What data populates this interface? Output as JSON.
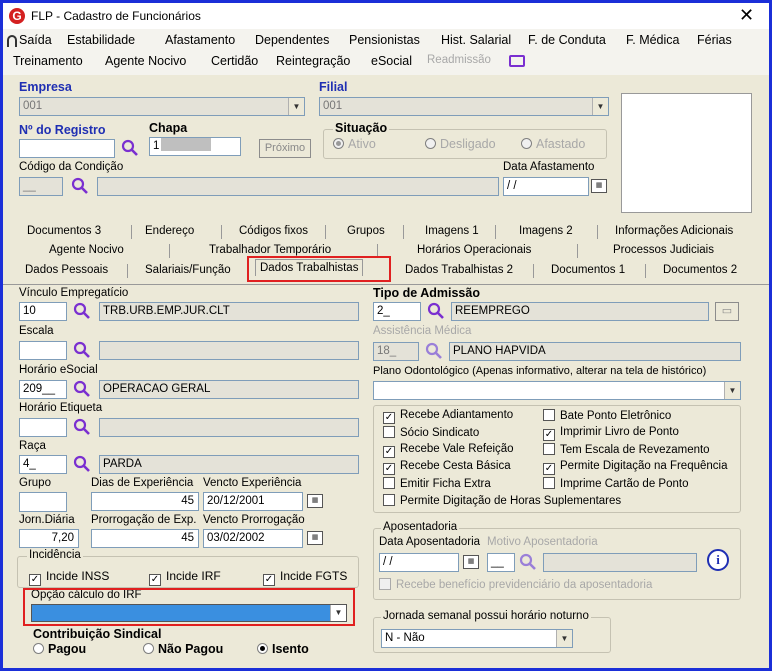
{
  "window": {
    "title": "FLP - Cadastro de Funcionários",
    "close": "✕",
    "logo": "G"
  },
  "menu": {
    "row1": [
      "Saída",
      "Estabilidade",
      "Afastamento",
      "Dependentes",
      "Pensionistas",
      "Hist. Salarial",
      "F. de Conduta",
      "F. Médica",
      "Férias"
    ],
    "row2": [
      "Treinamento",
      "Agente Nocivo",
      "Certidão",
      "Reintegração",
      "eSocial",
      "Readmissão"
    ]
  },
  "header": {
    "empresa_label": "Empresa",
    "empresa_value": "001",
    "filial_label": "Filial",
    "filial_value": "001",
    "registro_label": "Nº do Registro",
    "chapa_label": "Chapa",
    "chapa_value": "1",
    "proximo_button": "Próximo",
    "situacao_label": "Situação",
    "situacao_options": [
      "Ativo",
      "Desligado",
      "Afastado"
    ],
    "codigo_condicao_label": "Código da Condição",
    "codigo_condicao_value": "__",
    "data_afastamento_label": "Data Afastamento",
    "data_afastamento_value": " / /"
  },
  "tabs": {
    "row1": [
      "Documentos 3",
      "Endereço",
      "Códigos fixos",
      "Grupos",
      "Imagens 1",
      "Imagens 2",
      "Informações Adicionais"
    ],
    "row2": [
      "Agente Nocivo",
      "Trabalhador Temporário",
      "Horários Operacionais",
      "Processos Judiciais"
    ],
    "row3": [
      "Dados Pessoais",
      "Salariais/Função",
      "Dados Trabalhistas",
      "Dados Trabalhistas 2",
      "Documentos 1",
      "Documentos 2"
    ],
    "active": "Dados Trabalhistas"
  },
  "left": {
    "vinculo_label": "Vínculo Empregatício",
    "vinculo_code": "10",
    "vinculo_desc": "TRB.URB.EMP.JUR.CLT",
    "escala_label": "Escala",
    "horario_esocial_label": "Horário eSocial",
    "horario_esocial_code": "209__",
    "horario_esocial_desc": "OPERACAO GERAL",
    "horario_etiqueta_label": "Horário Etiqueta",
    "raca_label": "Raça",
    "raca_code": "4_",
    "raca_desc": "PARDA",
    "grupo_label": "Grupo",
    "dias_exp_label": "Dias de Experiência",
    "dias_exp_value": "45",
    "vencto_exp_label": "Vencto Experiência",
    "vencto_exp_value": "20/12/2001",
    "jorn_diaria_label": "Jorn.Diária",
    "jorn_diaria_value": "7,20",
    "prorrogacao_label": "Prorrogação de Exp.",
    "prorrogacao_value": "45",
    "vencto_prorrog_label": "Vencto Prorrogação",
    "vencto_prorrog_value": "03/02/2002",
    "incidencia_label": "Incidência",
    "incide_inss": "Incide INSS",
    "incide_irf": "Incide IRF",
    "incide_fgts": "Incide FGTS",
    "opcao_irf_label": "Opção cálculo do IRF",
    "contribuicao_label": "Contribuição Sindical",
    "contribuicao_options": [
      "Pagou",
      "Não Pagou",
      "Isento"
    ]
  },
  "right": {
    "tipo_admissao_label": "Tipo de Admissão",
    "tipo_admissao_code": "2_",
    "tipo_admissao_desc": "REEMPREGO",
    "assistencia_label": "Assistência Médica",
    "assistencia_code": "18_",
    "assistencia_desc": "PLANO HAPVIDA",
    "plano_odonto_label": "Plano Odontológico (Apenas informativo, alterar na tela de histórico)",
    "checks_left": [
      {
        "label": "Recebe Adiantamento",
        "checked": true
      },
      {
        "label": "Sócio Sindicato",
        "checked": false
      },
      {
        "label": "Recebe Vale Refeição",
        "checked": true
      },
      {
        "label": "Recebe Cesta Básica",
        "checked": true
      },
      {
        "label": "Emitir Ficha Extra",
        "checked": false
      },
      {
        "label": "Permite Digitação de Horas Suplementares",
        "checked": false
      }
    ],
    "checks_right": [
      {
        "label": "Bate Ponto Eletrônico",
        "checked": false
      },
      {
        "label": "Imprimir Livro de Ponto",
        "checked": true
      },
      {
        "label": "Tem Escala de Revezamento",
        "checked": false
      },
      {
        "label": "Permite Digitação na Frequência",
        "checked": true
      },
      {
        "label": "Imprime Cartão de Ponto",
        "checked": false
      }
    ],
    "aposentadoria_label": "Aposentadoria",
    "data_aposentadoria_label": "Data Aposentadoria",
    "data_aposentadoria_value": " / /",
    "motivo_label": "Motivo Aposentadoria",
    "motivo_value": "__",
    "beneficio_label": "Recebe benefício previdenciário da aposentadoria",
    "jornada_label": "Jornada semanal possui horário noturno",
    "jornada_value": "N - Não"
  },
  "colors": {
    "accent": "#1b2fd8",
    "highlight": "#e02020",
    "magnifier": "#7a2fd0"
  }
}
